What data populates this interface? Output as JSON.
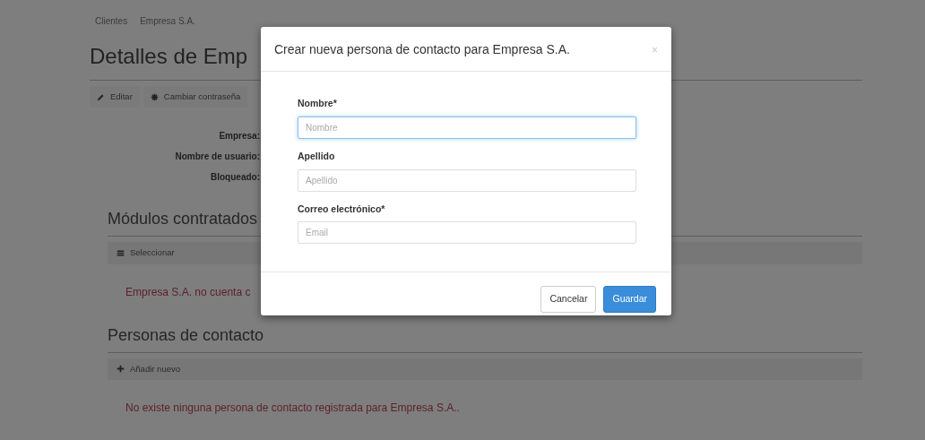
{
  "breadcrumb": [
    {
      "label": "Clientes"
    },
    {
      "label": "Empresa S.A."
    }
  ],
  "page_title": "Detalles de Emp",
  "toolbar": [
    {
      "label": "Editar"
    },
    {
      "label": "Cambiar contraseña"
    }
  ],
  "details": [
    {
      "label": "Empresa:"
    },
    {
      "label": "Nombre de usuario:"
    },
    {
      "label": "Bloqueado:"
    }
  ],
  "sections": [
    {
      "title": "Módulos contratados",
      "action": {
        "label": "Seleccionar"
      },
      "message": "Empresa S.A. no cuenta c"
    },
    {
      "title": "Personas de contacto",
      "action": {
        "label": "Añadir nuevo"
      },
      "message": "No existe ninguna persona de contacto registrada para Empresa S.A.."
    }
  ],
  "modal": {
    "title": "Crear nueva persona de contacto para Empresa S.A.",
    "close": "×",
    "fields": [
      {
        "label": "Nombre*",
        "placeholder": "Nombre",
        "focused": true
      },
      {
        "label": "Apellido",
        "placeholder": "Apellido",
        "focused": false
      },
      {
        "label": "Correo electrónico*",
        "placeholder": "Email",
        "focused": false
      }
    ],
    "buttons": [
      {
        "label": "Cancelar",
        "kind": "secondary"
      },
      {
        "label": "Guardar",
        "kind": "primary"
      }
    ]
  }
}
